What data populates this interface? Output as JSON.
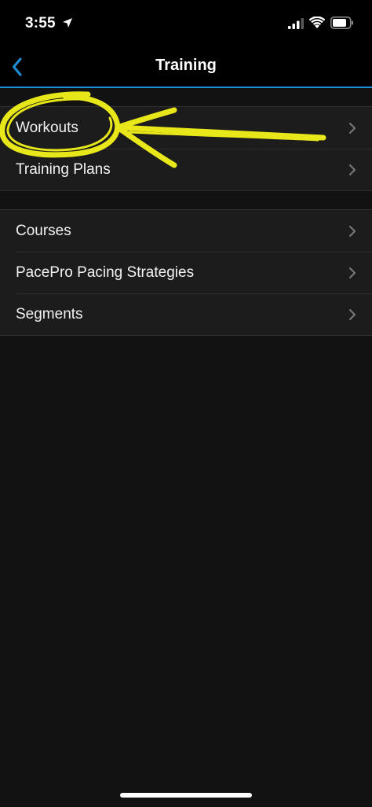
{
  "status_bar": {
    "time": "3:55",
    "icons": [
      "location-arrow-icon",
      "cellular-signal-icon",
      "wifi-icon",
      "battery-icon"
    ]
  },
  "nav": {
    "title": "Training",
    "back_icon": "chevron-left-icon",
    "accent_color": "#1e8fd6"
  },
  "groups": [
    {
      "items": [
        {
          "label": "Workouts"
        },
        {
          "label": "Training Plans"
        }
      ]
    },
    {
      "items": [
        {
          "label": "Courses"
        },
        {
          "label": "PacePro Pacing Strategies"
        },
        {
          "label": "Segments"
        }
      ]
    }
  ],
  "annotation": {
    "description_color": "#f2f21a",
    "marks": [
      "circle-around-workouts",
      "arrow-pointing-to-workouts"
    ]
  }
}
